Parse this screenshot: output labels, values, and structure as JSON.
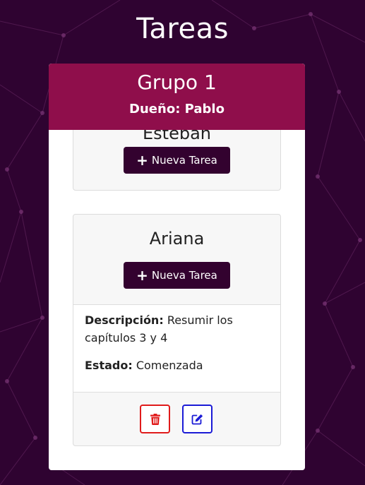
{
  "page": {
    "title": "Tareas"
  },
  "group": {
    "name": "Grupo 1",
    "owner": "Dueño: Pablo"
  },
  "members": [
    {
      "name": "Esteban",
      "new_task_label": "Nueva Tarea"
    },
    {
      "name": "Ariana",
      "new_task_label": "Nueva Tarea",
      "task": {
        "description_label": "Descripción:",
        "description": "Resumir los capítulos 3 y 4",
        "state_label": "Estado:",
        "state": "Comenzada"
      }
    }
  ],
  "colors": {
    "background": "#2f0331",
    "header": "#8f0e4b",
    "button": "#33022f",
    "delete": "#e01b1b",
    "edit": "#1b1bd6"
  },
  "icons": [
    "plus-icon",
    "trash-icon",
    "edit-icon"
  ]
}
